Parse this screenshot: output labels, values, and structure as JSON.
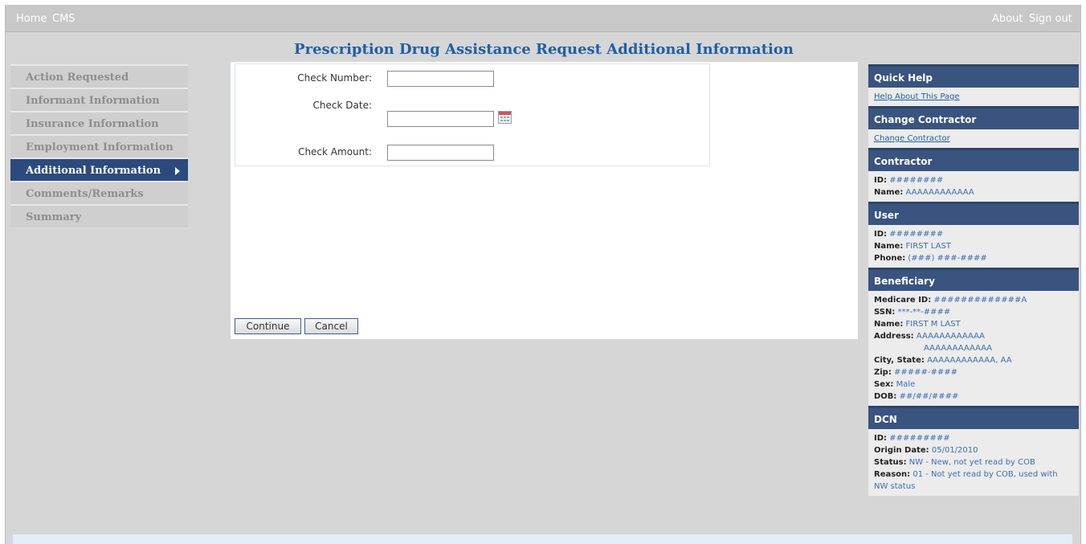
{
  "topnav": {
    "home": "Home",
    "cms": "CMS",
    "about": "About",
    "signout": "Sign out"
  },
  "page_title": "Prescription Drug Assistance Request Additional Information",
  "sidebar": {
    "items": [
      {
        "label": "Action Requested"
      },
      {
        "label": "Informant Information"
      },
      {
        "label": "Insurance Information"
      },
      {
        "label": "Employment Information"
      },
      {
        "label": "Additional Information"
      },
      {
        "label": "Comments/Remarks"
      },
      {
        "label": "Summary"
      }
    ],
    "active_index": 4
  },
  "form": {
    "check_number_label": "Check Number:",
    "check_number_value": "",
    "check_date_label": "Check Date:",
    "check_date_value": "",
    "check_amount_label": "Check Amount:",
    "check_amount_value": ""
  },
  "buttons": {
    "continue": "Continue",
    "cancel": "Cancel"
  },
  "right_panel": {
    "quick_help": {
      "title": "Quick Help",
      "link": "Help About This Page"
    },
    "change_contractor": {
      "title": "Change Contractor",
      "link": "Change Contractor"
    },
    "contractor": {
      "title": "Contractor",
      "id_label": "ID:",
      "id": "########",
      "name_label": "Name:",
      "name": "AAAAAAAAAAAA"
    },
    "user": {
      "title": "User",
      "id_label": "ID:",
      "id": "########",
      "name_label": "Name:",
      "name": "FIRST LAST",
      "phone_label": "Phone:",
      "phone": "(###) ###-####"
    },
    "beneficiary": {
      "title": "Beneficiary",
      "medicare_id_label": "Medicare ID:",
      "medicare_id": "#############A",
      "ssn_label": "SSN:",
      "ssn": "***-**-####",
      "name_label": "Name:",
      "name": "FIRST M LAST",
      "address_label": "Address:",
      "address_line1": "AAAAAAAAAAAA",
      "address_line2": "AAAAAAAAAAAA",
      "city_state_label": "City, State:",
      "city_state": "AAAAAAAAAAAA, AA",
      "zip_label": "Zip:",
      "zip": "#####-####",
      "sex_label": "Sex:",
      "sex": "Male",
      "dob_label": "DOB:",
      "dob": "##/##/####"
    },
    "dcn": {
      "title": "DCN",
      "id_label": "ID:",
      "id": "#########",
      "origin_date_label": "Origin Date:",
      "origin_date": "05/01/2010",
      "status_label": "Status:",
      "status": "NW - New, not yet read by COB",
      "reason_label": "Reason:",
      "reason": "01 - Not yet read by COB, used with NW status"
    }
  },
  "colors": {
    "accent": "#1f5fa6",
    "nav_active": "#2c4a7e",
    "panel_header": "#3a5480",
    "background": "#d6d6d6"
  }
}
